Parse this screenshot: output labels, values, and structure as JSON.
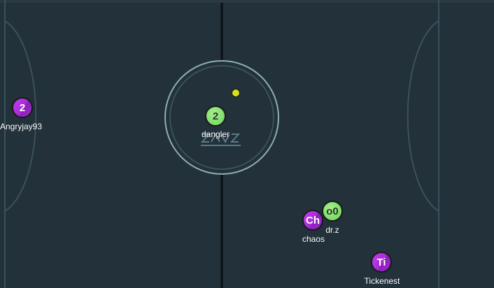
{
  "colors": {
    "field": "#22313a",
    "lines": "#3a525c",
    "center_circle": "#8fb0b3",
    "center_line": "#0b0f12",
    "team_green": "#7bdc6a",
    "team_purple": "#b233e0",
    "puck": "#d8e01c"
  },
  "center_logo": {
    "icon": "center-ice-logo-icon"
  },
  "players": [
    {
      "id": "dangler",
      "badge": "2",
      "name": "dangler",
      "team": "green"
    },
    {
      "id": "drz",
      "badge": "o0",
      "name": "dr.z",
      "team": "green"
    },
    {
      "id": "angryjay93",
      "badge": "2",
      "name": "Angryjay93",
      "team": "purple"
    },
    {
      "id": "chaos",
      "badge": "Ch",
      "name": "chaos",
      "team": "purple"
    },
    {
      "id": "tickenest",
      "badge": "Ti",
      "name": "Tickenest",
      "team": "purple"
    }
  ],
  "puck": {
    "icon": "puck-icon"
  }
}
